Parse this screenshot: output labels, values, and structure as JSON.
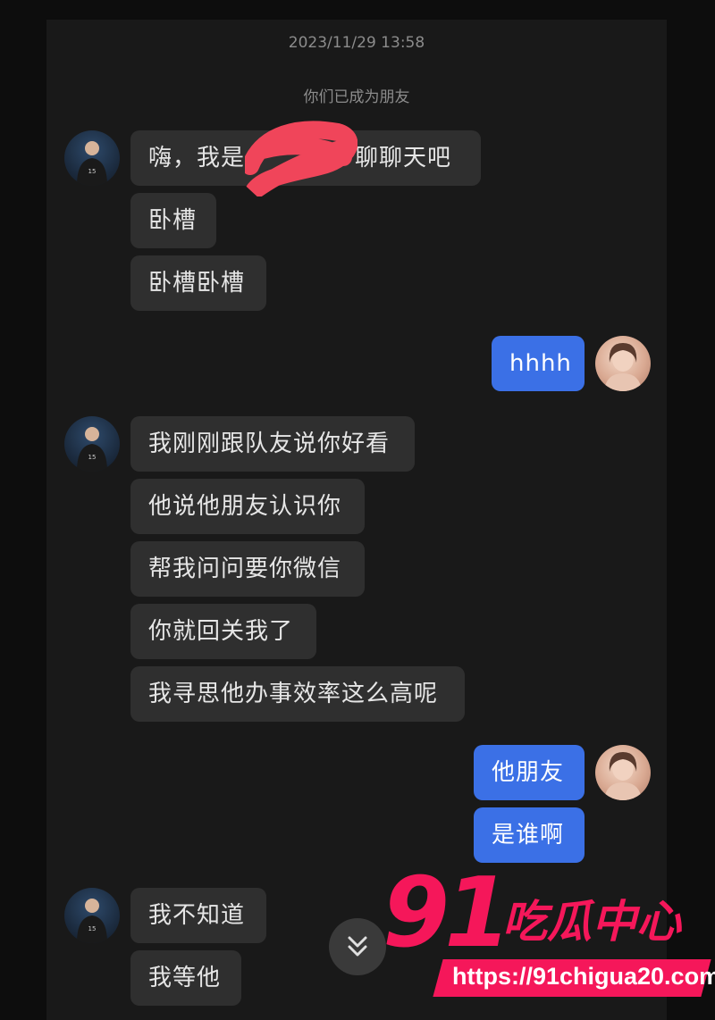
{
  "chat": {
    "timestamp": "2023/11/29 13:58",
    "system_message": "你们已成为朋友",
    "messages": [
      {
        "text": "嗨，我是",
        "after_redaction": "，聊聊天吧"
      },
      {
        "text": "卧槽"
      },
      {
        "text": "卧槽卧槽"
      },
      {
        "text": "hhhh"
      },
      {
        "text": "我刚刚跟队友说你好看"
      },
      {
        "text": "他说他朋友认识你"
      },
      {
        "text": "帮我问问要你微信"
      },
      {
        "text": "你就回关我了"
      },
      {
        "text": "我寻思他办事效率这么高呢"
      },
      {
        "text": "他朋友"
      },
      {
        "text": "是谁啊"
      },
      {
        "text": "我不知道"
      },
      {
        "text": "我等他"
      }
    ],
    "scroll_button_icon": "double-chevron-down-icon"
  },
  "watermark": {
    "number": "91",
    "title": "吃瓜中心",
    "url": "https://91chigua20.com"
  },
  "colors": {
    "incoming_bubble": "#2f2f2f",
    "outgoing_bubble": "#3b70e6",
    "redaction": "#f0455a",
    "watermark": "#f5175a"
  }
}
